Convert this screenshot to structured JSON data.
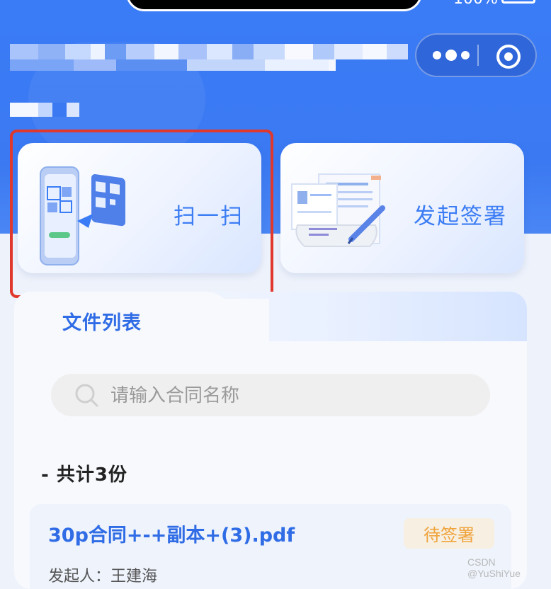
{
  "status_bar": {
    "battery_text": "100%"
  },
  "nav": {
    "more_icon": "more-dots-icon",
    "close_icon": "target-circle-icon"
  },
  "actions": [
    {
      "label": "扫一扫",
      "icon": "qr-scan-illustration"
    },
    {
      "label": "发起签署",
      "icon": "document-pen-illustration"
    }
  ],
  "file_list": {
    "title": "文件列表",
    "search_placeholder": "请输入合同名称",
    "count_label": "- 共计3份",
    "documents": [
      {
        "name": "30p合同+-+副本+(3).pdf",
        "status": "待签署",
        "initiator": "发起人：王建海"
      }
    ]
  },
  "watermark": "CSDN @YuShiYue",
  "colors": {
    "primary": "#3a7cf6",
    "highlight_border": "#e0382c",
    "status_pending": "#f0a33b"
  }
}
